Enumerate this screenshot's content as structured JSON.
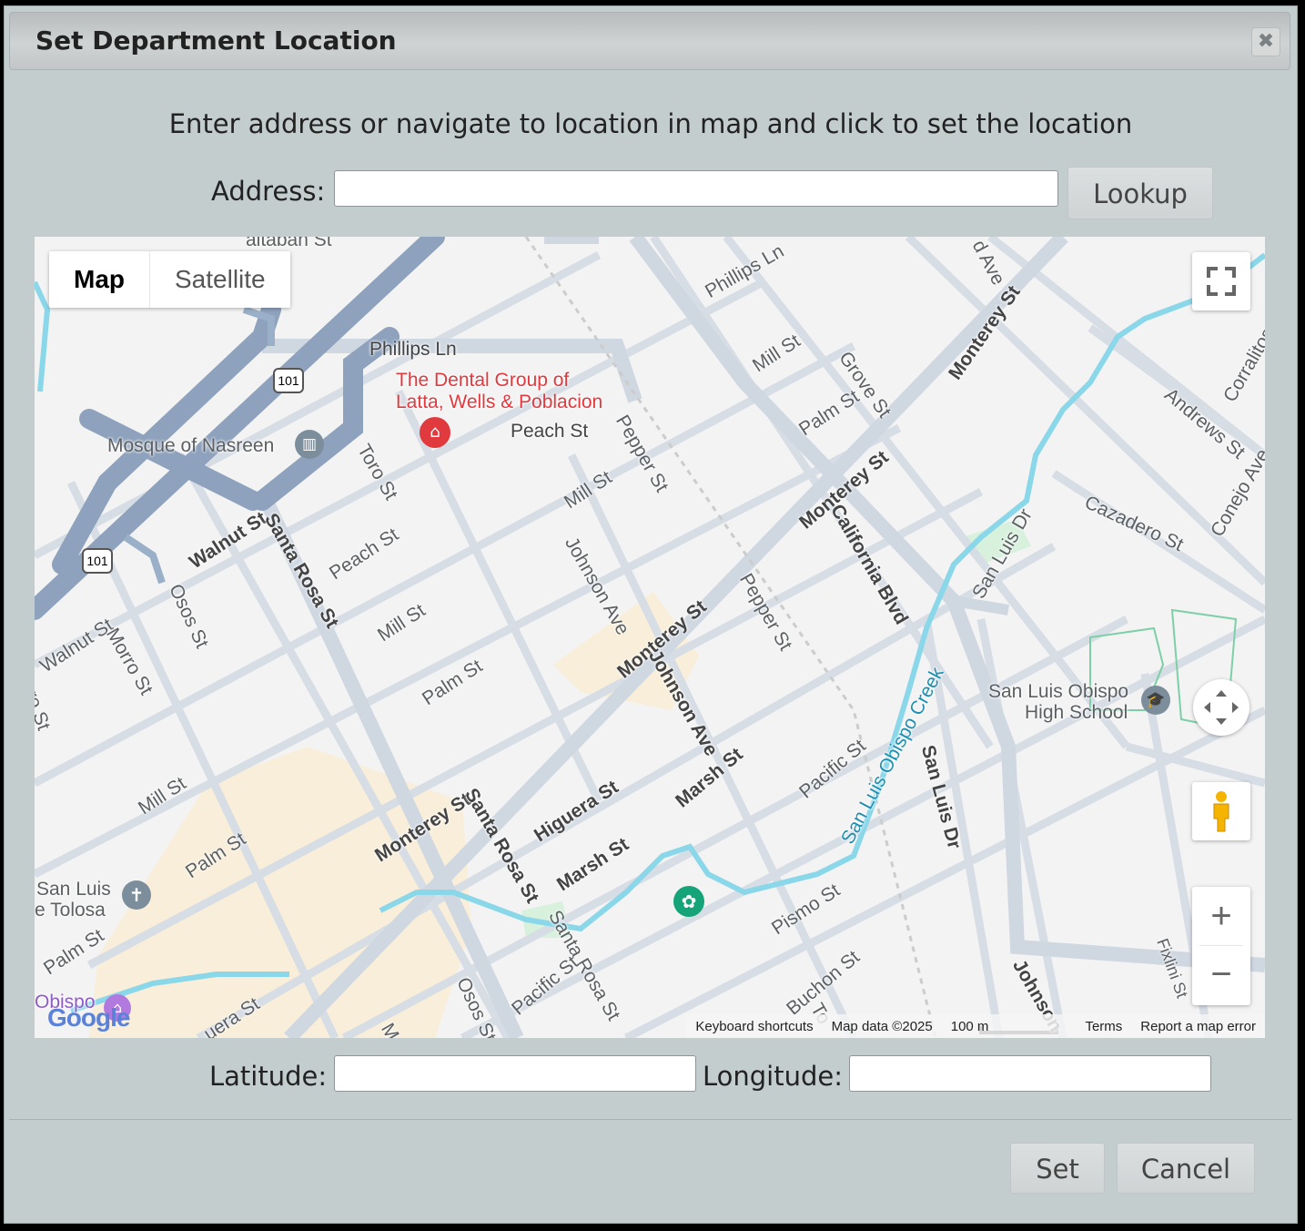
{
  "dialog": {
    "title": "Set Department Location",
    "close_icon": "close-icon",
    "instructions": "Enter address or navigate to location in map and click to set the location",
    "address_label": "Address:",
    "address_value": "",
    "lookup_label": "Lookup",
    "latitude_label": "Latitude:",
    "latitude_value": "",
    "longitude_label": "Longitude:",
    "longitude_value": "",
    "set_label": "Set",
    "cancel_label": "Cancel"
  },
  "map": {
    "type_options": [
      "Map",
      "Satellite"
    ],
    "selected_type": "Map",
    "attribution": {
      "keyboard": "Keyboard shortcuts",
      "data": "Map data ©2025",
      "scale": "100 m",
      "terms": "Terms",
      "report": "Report a map error"
    },
    "logo": "Google",
    "places": {
      "dental": "The Dental Group of",
      "dental2": "Latta, Wells & Poblacion",
      "mosque": "Mosque of Nasreen",
      "school1": "San Luis Obispo",
      "school2": "High School",
      "church1": "San Luis",
      "church2": "e Tolosa",
      "obispo": "Obispo"
    },
    "streets": {
      "phillips_ln": "Phillips Ln",
      "phillips_ln2": "Phillips Ln",
      "peach_st": "Peach St",
      "peach_st2": "Peach St",
      "mill_st1": "Mill St",
      "mill_st2": "Mill St",
      "mill_st3": "Mill St",
      "mill_st4": "Mill St",
      "palm_st1": "Palm St",
      "palm_st2": "Palm St",
      "palm_st3": "Palm St",
      "palm_st4": "Palm St",
      "grove_st": "Grove St",
      "monterey1": "Monterey St",
      "monterey2": "Monterey St",
      "monterey3": "Monterey St",
      "monterey4": "Monterey St",
      "pepper1": "Pepper St",
      "pepper2": "Pepper St",
      "toro_st": "Toro St",
      "walnut1": "Walnut St",
      "walnut2": "Walnut St",
      "santa_rosa1": "Santa Rosa St",
      "santa_rosa2": "Santa Rosa St",
      "santa_rosa3": "Santa Rosa St",
      "osos1": "Osos St",
      "osos2": "Osos St",
      "morro": "Morro St",
      "johnson1": "Johnson Ave",
      "johnson2": "Johnson Ave",
      "johnson3": "Johnson",
      "california": "California Blvd",
      "higuera": "Higuera St",
      "marsh1": "Marsh St",
      "marsh2": "Marsh St",
      "pacific1": "Pacific St",
      "pacific2": "Pacific St",
      "pismo": "Pismo St",
      "buchon": "Buchon St",
      "slo_creek": "San Luis Obispo Creek",
      "san_luis_dr1": "San Luis Dr",
      "san_luis_dr2": "San Luis Dr",
      "andrews": "Andrews St",
      "corralitos": "Corralitos",
      "cazadero": "Cazadero St",
      "conejo": "Conejo Ave",
      "fixlini": "Fixlini St",
      "hwy101a": "101",
      "hwy101b": "101",
      "ave_top": "d Ave",
      "talban": "altaban St",
      "uera": "uera St",
      "mo": "Mo",
      "to": "To",
      "orro": "orro St"
    }
  },
  "colors": {
    "dialog_bg": "#c4cdce",
    "map_bg": "#f3f3f3",
    "road": "#d6dce3",
    "highway": "#8ea2bd",
    "water": "#8ad7ea",
    "poi_red": "#e0393e"
  }
}
